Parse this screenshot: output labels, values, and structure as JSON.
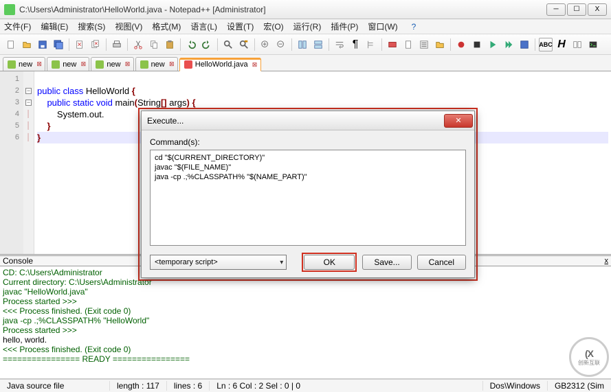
{
  "window": {
    "title": "C:\\Users\\Administrator\\HelloWorld.java - Notepad++ [Administrator]",
    "min": "─",
    "max": "☐",
    "close": "X"
  },
  "menu": [
    "文件(F)",
    "编辑(E)",
    "搜索(S)",
    "视图(V)",
    "格式(M)",
    "语言(L)",
    "设置(T)",
    "宏(O)",
    "运行(R)",
    "插件(P)",
    "窗口(W)"
  ],
  "menu_help": "?",
  "tabs": [
    {
      "label": "new",
      "dirty": false
    },
    {
      "label": "new",
      "dirty": false
    },
    {
      "label": "new",
      "dirty": false
    },
    {
      "label": "new",
      "dirty": false
    },
    {
      "label": "HelloWorld.java",
      "dirty": true,
      "active": true
    }
  ],
  "editor": {
    "lines": [
      {
        "n": 1,
        "raw": ""
      },
      {
        "n": 2,
        "raw": "public class HelloWorld {",
        "tokens": [
          [
            "k-blue",
            "public class "
          ],
          [
            "txt",
            "HelloWorld "
          ],
          [
            "br",
            "{"
          ]
        ]
      },
      {
        "n": 3,
        "raw": "    public static void main(String[] args) {",
        "tokens": [
          [
            "txt",
            "    "
          ],
          [
            "k-blue",
            "public static void "
          ],
          [
            "txt",
            "main"
          ],
          [
            "br",
            "("
          ],
          [
            "txt",
            "String"
          ],
          [
            "br",
            "[]"
          ],
          [
            "txt",
            " args"
          ],
          [
            "br",
            ") {"
          ]
        ]
      },
      {
        "n": 4,
        "raw": "        System.out.",
        "tokens": [
          [
            "txt",
            "        System.out."
          ]
        ]
      },
      {
        "n": 5,
        "raw": "    }",
        "tokens": [
          [
            "txt",
            "    "
          ],
          [
            "br",
            "}"
          ]
        ]
      },
      {
        "n": 6,
        "raw": "}",
        "tokens": [
          [
            "br",
            "}"
          ]
        ],
        "selected": true
      }
    ]
  },
  "console": {
    "title": "Console",
    "lines": [
      "CD: C:\\Users\\Administrator",
      "Current directory: C:\\Users\\Administrator",
      "javac \"HelloWorld.java\"",
      "Process started >>>",
      "<<< Process finished. (Exit code 0)",
      "java -cp .;%CLASSPATH% \"HelloWorld\"",
      "Process started >>>",
      "hello, world.",
      "<<< Process finished. (Exit code 0)",
      "================ READY ================"
    ],
    "out_index": 7
  },
  "status": {
    "type": "Java source file",
    "length": "length : 117",
    "lines": "lines : 6",
    "pos": "Ln : 6    Col : 2    Sel : 0 | 0",
    "eol": "Dos\\Windows",
    "enc": "GB2312 (Sim"
  },
  "dialog": {
    "title": "Execute...",
    "label": "Command(s):",
    "commands": "cd \"$(CURRENT_DIRECTORY)\"\njavac \"$(FILE_NAME)\"\njava -cp .;%CLASSPATH% \"$(NAME_PART)\"",
    "combo": "<temporary script>",
    "ok": "OK",
    "save": "Save...",
    "cancel": "Cancel"
  },
  "watermark": {
    "big": "(X",
    "small": "创新互联"
  }
}
